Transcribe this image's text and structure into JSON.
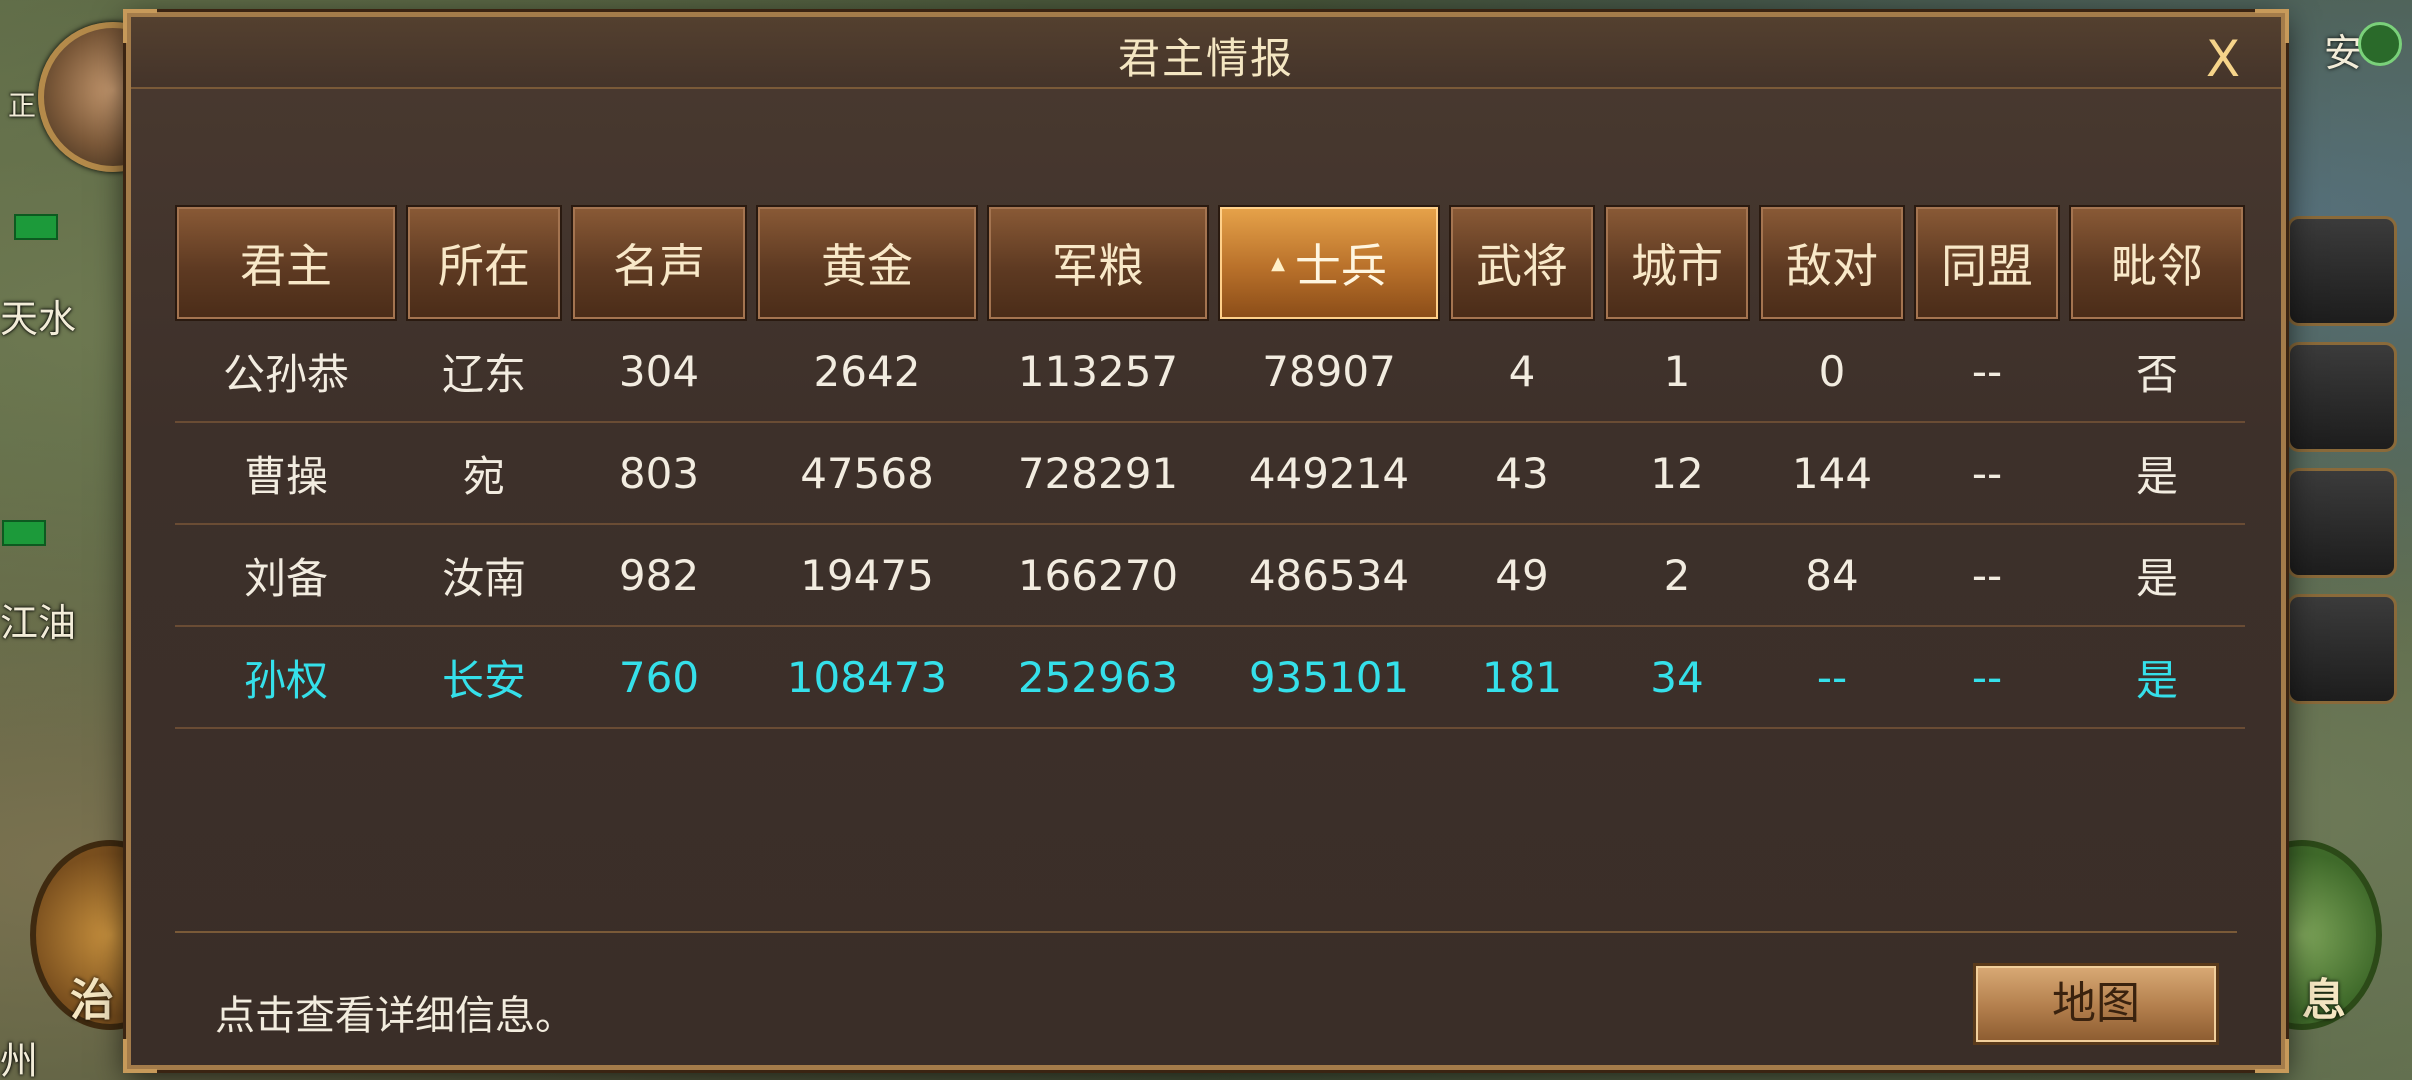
{
  "background": {
    "labels": [
      "天水",
      "江油",
      "正",
      "安",
      "州"
    ],
    "left_button_glyph": "治",
    "right_button_glyph": "息"
  },
  "dialog": {
    "title": "君主情报",
    "close_label": "X",
    "columns": [
      "君主",
      "所在",
      "名声",
      "黄金",
      "军粮",
      "士兵",
      "武将",
      "城市",
      "敌对",
      "同盟",
      "毗邻"
    ],
    "sorted_column": "士兵",
    "rows": [
      {
        "lord": "公孙恭",
        "location": "辽东",
        "fame": "304",
        "gold": "2642",
        "food": "113257",
        "soldiers": "78907",
        "generals": "4",
        "cities": "1",
        "hostile": "0",
        "alliance": "--",
        "adjacent": "否",
        "is_self": false
      },
      {
        "lord": "曹操",
        "location": "宛",
        "fame": "803",
        "gold": "47568",
        "food": "728291",
        "soldiers": "449214",
        "generals": "43",
        "cities": "12",
        "hostile": "144",
        "alliance": "--",
        "adjacent": "是",
        "is_self": false
      },
      {
        "lord": "刘备",
        "location": "汝南",
        "fame": "982",
        "gold": "19475",
        "food": "166270",
        "soldiers": "486534",
        "generals": "49",
        "cities": "2",
        "hostile": "84",
        "alliance": "--",
        "adjacent": "是",
        "is_self": false
      },
      {
        "lord": "孙权",
        "location": "长安",
        "fame": "760",
        "gold": "108473",
        "food": "252963",
        "soldiers": "935101",
        "generals": "181",
        "cities": "34",
        "hostile": "--",
        "alliance": "--",
        "adjacent": "是",
        "is_self": true
      }
    ],
    "hint": "点击查看详细信息。",
    "map_button_label": "地图"
  },
  "colors": {
    "self_row": "#35e0ea",
    "active_header": "#e7a34a",
    "frame": "#a47c4a"
  }
}
